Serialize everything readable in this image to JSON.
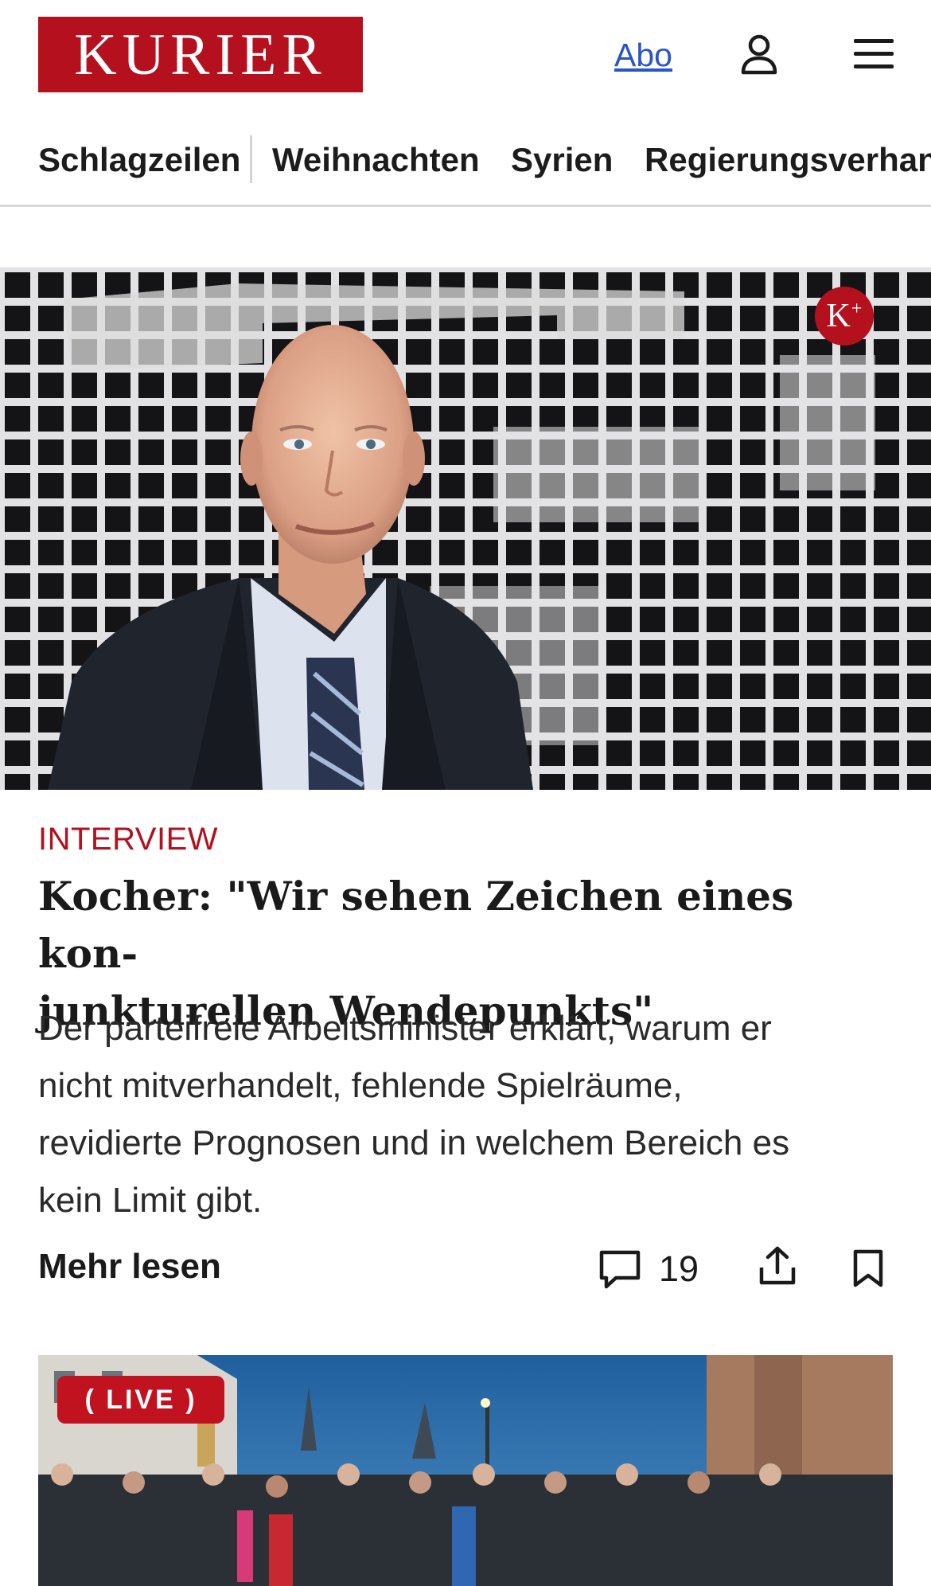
{
  "header": {
    "logo_text": "KURIER",
    "abo_label": "Abo",
    "user_icon": "user-icon",
    "menu_icon": "hamburger-menu-icon"
  },
  "nav": {
    "items": [
      "Schlagzeilen",
      "Weihnachten",
      "Syrien",
      "Regierungsverhand"
    ]
  },
  "lead_article": {
    "badge": "K+",
    "kicker": "INTERVIEW",
    "headline_line1": "Kocher: \"Wir sehen Zeichen eines kon-",
    "headline_line2": "junkturellen Wendepunkts\"",
    "teaser_line1": "Der parteifreie Arbeitsminister erklärt, warum er",
    "teaser_line2": "nicht mitverhandelt, fehlende Spielräume,",
    "teaser_line3": "revidierte Prognosen und in welchem Bereich es",
    "teaser_line4": "kein Limit gibt.",
    "more_label": "Mehr lesen",
    "comment_count": "19"
  },
  "second_article": {
    "live_label": "LIVE"
  },
  "colors": {
    "brand_red": "#b4101e",
    "link_blue": "#2a55c9"
  }
}
